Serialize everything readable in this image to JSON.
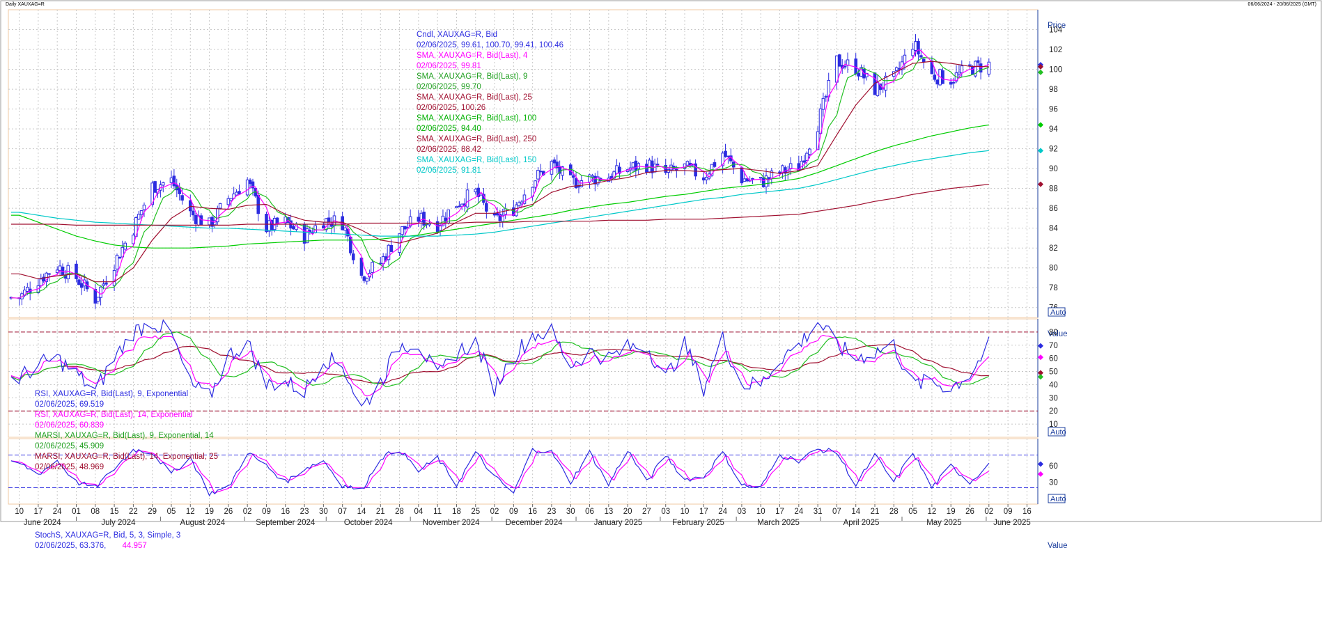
{
  "header": {
    "left_title": "Daily XAUXAG=R",
    "right_range": "06/06/2024 - 20/06/2025 (GMT)"
  },
  "colors": {
    "candle": "#2c2ce0",
    "sma4": "#ff00ff",
    "sma9": "#22c022",
    "sma25": "#a01030",
    "sma100": "#00cc00",
    "sma250": "#a01030",
    "sma150": "#00c8c8",
    "rsi9": "#2c2ce0",
    "rsi14": "#ff00ff",
    "marsi9": "#22c022",
    "marsi14": "#a01030",
    "stochK": "#2c2ce0",
    "stochD": "#ff00ff",
    "axis": "#1a3c9c",
    "grid": "#c8c8c8",
    "refline": "#a01030"
  },
  "price_panel": {
    "axis_title": "Price",
    "auto": "Auto",
    "ticks": [
      "76",
      "78",
      "80",
      "82",
      "84",
      "86",
      "88",
      "90",
      "92",
      "94",
      "96",
      "98",
      "100",
      "102",
      "104"
    ],
    "legend": [
      {
        "name": "Cndl, XAUXAG=R, Bid",
        "value": "02/06/2025, 99.61, 100.70, 99.41, 100.46",
        "color": "#2c2ce0"
      },
      {
        "name": "SMA, XAUXAG=R, Bid(Last), 4",
        "value": "02/06/2025, 99.81",
        "color": "#ff00ff"
      },
      {
        "name": "SMA, XAUXAG=R, Bid(Last), 9",
        "value": "02/06/2025, 99.70",
        "color": "#22a022"
      },
      {
        "name": "SMA, XAUXAG=R, Bid(Last), 25",
        "value": "02/06/2025, 100.26",
        "color": "#a01030"
      },
      {
        "name": "SMA, XAUXAG=R, Bid(Last), 100",
        "value": "02/06/2025, 94.40",
        "color": "#00b000"
      },
      {
        "name": "SMA, XAUXAG=R, Bid(Last), 250",
        "value": "02/06/2025, 88.42",
        "color": "#a01030"
      },
      {
        "name": "SMA, XAUXAG=R, Bid(Last), 150",
        "value": "02/06/2025, 91.81",
        "color": "#00c8c8"
      }
    ]
  },
  "rsi_panel": {
    "axis_title": "Value",
    "auto": "Auto",
    "ticks": [
      "10",
      "20",
      "30",
      "40",
      "50",
      "60",
      "70",
      "80"
    ],
    "legend": [
      {
        "name": "RSI, XAUXAG=R, Bid(Last), 9, Exponential",
        "value": "02/06/2025, 69.519",
        "color": "#2c2ce0"
      },
      {
        "name": "RSI, XAUXAG=R, Bid(Last), 14, Exponential",
        "value": "02/06/2025, 60.839",
        "color": "#ff00ff"
      },
      {
        "name": "MARSI, XAUXAG=R, Bid(Last), 9, Exponential, 14",
        "value": "02/06/2025, 45.909",
        "color": "#22a022"
      },
      {
        "name": "MARSI, XAUXAG=R, Bid(Last), 14, Exponential, 25",
        "value": "02/06/2025, 48.969",
        "color": "#a01030"
      }
    ]
  },
  "stoch_panel": {
    "axis_title": "Value",
    "auto": "Auto",
    "ticks": [
      "30",
      "60"
    ],
    "legend": [
      {
        "name": "StochS, XAUXAG=R, Bid, 5, 3, Simple, 3",
        "value": "",
        "color": "#2c2ce0"
      }
    ],
    "legend_values": [
      {
        "text": "02/06/2025, 63.376,",
        "color": "#2c2ce0"
      },
      {
        "text": "44.957",
        "color": "#ff00ff"
      }
    ]
  },
  "x_axis": {
    "day_ticks": [
      "10",
      "17",
      "24",
      "01",
      "08",
      "15",
      "22",
      "29",
      "05",
      "12",
      "19",
      "26",
      "02",
      "09",
      "16",
      "23",
      "30",
      "07",
      "14",
      "21",
      "28",
      "04",
      "11",
      "18",
      "25",
      "02",
      "09",
      "16",
      "23",
      "30",
      "06",
      "13",
      "20",
      "27",
      "03",
      "10",
      "17",
      "24",
      "03",
      "10",
      "17",
      "24",
      "31",
      "07",
      "14",
      "21",
      "28",
      "05",
      "12",
      "19",
      "26",
      "02",
      "09",
      "16"
    ],
    "months": [
      "June 2024",
      "July 2024",
      "August 2024",
      "September 2024",
      "October 2024",
      "November 2024",
      "December 2024",
      "January 2025",
      "February 2025",
      "March 2025",
      "April 2025",
      "May 2025",
      "June 2025"
    ]
  },
  "chart_data": {
    "type": "line",
    "title": "Daily XAUXAG=R",
    "x": [
      "2024-06-10",
      "2024-06-17",
      "2024-06-24",
      "2024-07-01",
      "2024-07-08",
      "2024-07-15",
      "2024-07-22",
      "2024-07-29",
      "2024-08-05",
      "2024-08-12",
      "2024-08-19",
      "2024-08-26",
      "2024-09-02",
      "2024-09-09",
      "2024-09-16",
      "2024-09-23",
      "2024-09-30",
      "2024-10-07",
      "2024-10-14",
      "2024-10-21",
      "2024-10-28",
      "2024-11-04",
      "2024-11-11",
      "2024-11-18",
      "2024-11-25",
      "2024-12-02",
      "2024-12-09",
      "2024-12-16",
      "2024-12-23",
      "2024-12-30",
      "2025-01-06",
      "2025-01-13",
      "2025-01-20",
      "2025-01-27",
      "2025-02-03",
      "2025-02-10",
      "2025-02-17",
      "2025-02-24",
      "2025-03-03",
      "2025-03-10",
      "2025-03-17",
      "2025-03-24",
      "2025-03-31",
      "2025-04-07",
      "2025-04-14",
      "2025-04-21",
      "2025-04-28",
      "2025-05-05",
      "2025-05-12",
      "2025-05-19",
      "2025-05-26",
      "2025-06-02"
    ],
    "ylim": [
      75,
      106
    ],
    "series": [
      {
        "name": "Cndl, XAUXAG=R, Bid",
        "values": [
          77.0,
          78.8,
          80.2,
          79.0,
          76.9,
          80.5,
          84.0,
          88.2,
          88.8,
          85.5,
          84.3,
          87.0,
          88.8,
          84.0,
          84.6,
          83.2,
          84.8,
          84.6,
          79.2,
          80.5,
          83.6,
          85.0,
          84.4,
          86.5,
          87.6,
          84.6,
          86.0,
          88.8,
          90.5,
          88.6,
          89.0,
          89.2,
          90.0,
          90.4,
          89.5,
          90.1,
          89.2,
          91.6,
          89.0,
          88.6,
          89.6,
          90.2,
          94.5,
          100.8,
          100.2,
          98.0,
          99.0,
          102.6,
          99.4,
          99.0,
          100.1,
          100.46
        ]
      },
      {
        "name": "SMA, XAUXAG=R, Bid(Last), 25",
        "values": [
          79.4,
          78.9,
          79.2,
          79.4,
          78.6,
          78.6,
          80.0,
          82.8,
          85.0,
          86.2,
          86.0,
          85.9,
          86.3,
          86.4,
          85.4,
          84.8,
          84.6,
          84.6,
          83.8,
          82.8,
          82.5,
          83.0,
          83.5,
          84.6,
          85.5,
          85.5,
          85.9,
          86.4,
          87.6,
          88.2,
          88.4,
          88.8,
          89.1,
          89.6,
          89.8,
          89.8,
          89.7,
          89.9,
          90.0,
          89.8,
          89.5,
          89.8,
          90.3,
          93.4,
          96.4,
          98.6,
          99.6,
          100.6,
          100.8,
          100.6,
          100.3,
          100.26
        ]
      },
      {
        "name": "SMA, XAUXAG=R, Bid(Last), 100",
        "values": [
          85.3,
          84.6,
          83.9,
          83.2,
          82.7,
          82.3,
          82.1,
          82.0,
          82.0,
          82.0,
          82.1,
          82.2,
          82.4,
          82.5,
          82.6,
          82.7,
          82.8,
          82.8,
          82.8,
          82.9,
          83.1,
          83.3,
          83.6,
          83.9,
          84.2,
          84.5,
          84.8,
          85.1,
          85.4,
          85.8,
          86.1,
          86.4,
          86.6,
          86.9,
          87.2,
          87.4,
          87.7,
          88.0,
          88.2,
          88.4,
          88.7,
          89.0,
          89.6,
          90.3,
          91.0,
          91.7,
          92.3,
          92.8,
          93.3,
          93.7,
          94.1,
          94.4
        ]
      },
      {
        "name": "SMA, XAUXAG=R, Bid(Last), 150",
        "values": [
          85.6,
          85.3,
          85.0,
          84.8,
          84.6,
          84.5,
          84.4,
          84.3,
          84.2,
          84.1,
          84.0,
          84.0,
          83.9,
          83.8,
          83.7,
          83.6,
          83.5,
          83.4,
          83.3,
          83.2,
          83.2,
          83.2,
          83.2,
          83.3,
          83.4,
          83.6,
          83.9,
          84.2,
          84.5,
          84.8,
          85.1,
          85.4,
          85.7,
          86.0,
          86.3,
          86.6,
          86.9,
          87.1,
          87.4,
          87.6,
          87.8,
          88.0,
          88.4,
          88.9,
          89.4,
          89.9,
          90.3,
          90.7,
          91.0,
          91.3,
          91.6,
          91.81
        ]
      },
      {
        "name": "SMA, XAUXAG=R, Bid(Last), 250",
        "values": [
          84.4,
          84.4,
          84.4,
          84.3,
          84.3,
          84.3,
          84.3,
          84.3,
          84.3,
          84.3,
          84.3,
          84.3,
          84.4,
          84.4,
          84.4,
          84.4,
          84.4,
          84.4,
          84.5,
          84.5,
          84.5,
          84.5,
          84.5,
          84.5,
          84.6,
          84.6,
          84.6,
          84.7,
          84.7,
          84.7,
          84.7,
          84.8,
          84.8,
          84.8,
          84.9,
          84.9,
          84.9,
          85.0,
          85.1,
          85.2,
          85.3,
          85.4,
          85.7,
          86.0,
          86.3,
          86.7,
          87.0,
          87.4,
          87.7,
          88.0,
          88.2,
          88.42
        ]
      },
      {
        "name": "RSI, XAUXAG=R, Bid(Last), 9, Exponential",
        "values": [
          45,
          55,
          60,
          48,
          35,
          60,
          80,
          88,
          78,
          40,
          30,
          62,
          72,
          40,
          42,
          35,
          60,
          55,
          22,
          42,
          70,
          72,
          45,
          65,
          72,
          38,
          62,
          78,
          80,
          55,
          65,
          60,
          68,
          70,
          45,
          70,
          38,
          75,
          40,
          40,
          60,
          70,
          88,
          70,
          60,
          65,
          70,
          40,
          42,
          38,
          48,
          69.5
        ]
      },
      {
        "name": "StochS, XAUXAG=R, Bid, 5, 3, Simple, 3",
        "values": [
          65,
          45,
          70,
          30,
          20,
          55,
          90,
          85,
          45,
          75,
          10,
          20,
          85,
          60,
          30,
          55,
          70,
          25,
          15,
          75,
          90,
          50,
          75,
          25,
          85,
          40,
          10,
          90,
          85,
          30,
          85,
          25,
          90,
          30,
          80,
          35,
          40,
          85,
          25,
          20,
          80,
          70,
          90,
          85,
          25,
          80,
          30,
          85,
          20,
          60,
          30,
          63.4
        ]
      }
    ]
  }
}
